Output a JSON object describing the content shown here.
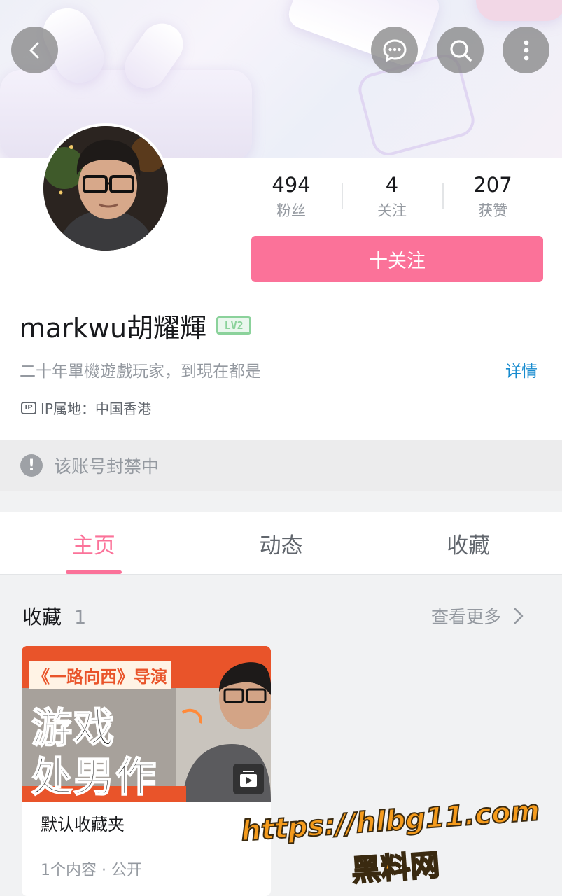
{
  "header": {
    "back_icon": "chevron-left-icon",
    "message_icon": "chat-bubble-icon",
    "search_icon": "search-icon",
    "more_icon": "more-vertical-icon"
  },
  "profile": {
    "stats": [
      {
        "value": "494",
        "label": "粉丝"
      },
      {
        "value": "4",
        "label": "关注"
      },
      {
        "value": "207",
        "label": "获赞"
      }
    ],
    "follow_label": "十关注",
    "username": "markwu胡耀輝",
    "level_badge": "LV2",
    "bio": "二十年單機遊戲玩家，到現在都是",
    "detail_link": "详情",
    "ip_badge": "IP",
    "ip_location": "IP属地：中国香港"
  },
  "notice": {
    "text": "该账号封禁中"
  },
  "tabs": [
    {
      "label": "主页",
      "active": true
    },
    {
      "label": "动态",
      "active": false
    },
    {
      "label": "收藏",
      "active": false
    }
  ],
  "favorites": {
    "title": "收藏",
    "count": "1",
    "more_label": "查看更多",
    "card": {
      "thumb_banner": "《一路向西》导演",
      "thumb_line1": "游戏",
      "thumb_line2": "处男作",
      "title": "默认收藏夹",
      "meta": "1个内容 · 公开"
    }
  },
  "watermark": {
    "url": "https://hlbg11.com",
    "name": "黑料网"
  },
  "colors": {
    "accent": "#fb7299",
    "link": "#178bcf",
    "level": "#8bd29b"
  }
}
